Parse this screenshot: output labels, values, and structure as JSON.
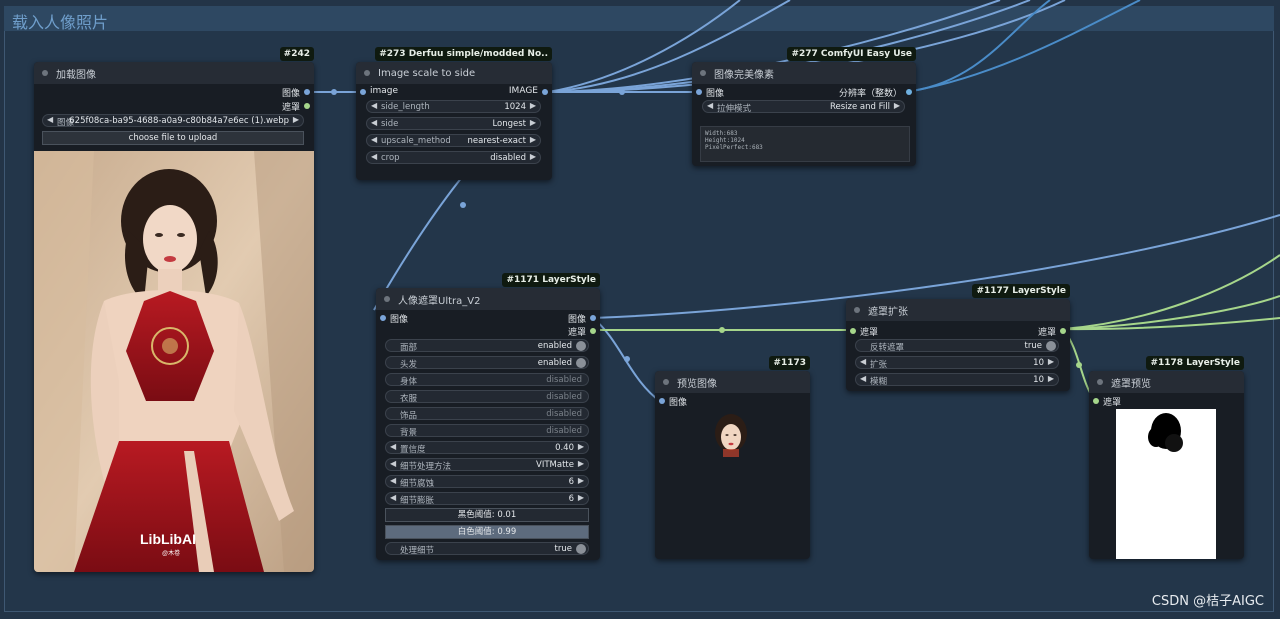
{
  "group": {
    "title": "载入人像照片"
  },
  "nodes": {
    "load_image": {
      "badge": "#242",
      "title": "加载图像",
      "outputs": [
        "图像",
        "遮罩"
      ],
      "image_label": "图像",
      "image_value": "625f08ca-ba95-4688-a0a9-c80b84a7e6ec (1).webp",
      "upload_label": "choose file to upload",
      "preview_brand": "LibLibAI",
      "preview_sub": "@木卷"
    },
    "scale": {
      "badge": "#273 Derfuu simple/modded No..",
      "title": "Image scale to side",
      "input": "image",
      "output": "IMAGE",
      "widgets": [
        {
          "label": "side_length",
          "value": "1024"
        },
        {
          "label": "side",
          "value": "Longest"
        },
        {
          "label": "upscale_method",
          "value": "nearest-exact"
        },
        {
          "label": "crop",
          "value": "disabled"
        }
      ]
    },
    "pixel": {
      "badge": "#277 ComfyUI Easy Use",
      "title": "图像完美像素",
      "input": "图像",
      "output": "分辨率（整数）",
      "widget": {
        "label": "拉伸模式",
        "value": "Resize and Fill"
      },
      "info": [
        "Width:683",
        "Height:1024",
        "PixelPerfect:683"
      ]
    },
    "mask_ultra": {
      "badge": "#1171 LayerStyle",
      "title": "人像遮罩Ultra_V2",
      "input": "图像",
      "outputs": [
        "图像",
        "遮罩"
      ],
      "toggles": [
        {
          "label": "面部",
          "value": "enabled"
        },
        {
          "label": "头发",
          "value": "enabled"
        },
        {
          "label": "身体",
          "value": "disabled"
        },
        {
          "label": "衣服",
          "value": "disabled"
        },
        {
          "label": "饰品",
          "value": "disabled"
        },
        {
          "label": "背景",
          "value": "disabled"
        }
      ],
      "numbers": [
        {
          "label": "置信度",
          "value": "0.40"
        },
        {
          "label": "细节处理方法",
          "value": "VITMatte"
        },
        {
          "label": "细节腐蚀",
          "value": "6"
        },
        {
          "label": "细节膨胀",
          "value": "6"
        }
      ],
      "black_point": "黑色阈值: 0.01",
      "white_point": "白色阈值: 0.99",
      "process_detail": {
        "label": "处理细节",
        "value": "true"
      }
    },
    "preview": {
      "badge": "#1173",
      "title": "预览图像",
      "input": "图像"
    },
    "mask_grow": {
      "badge": "#1177 LayerStyle",
      "title": "遮罩扩张",
      "input": "遮罩",
      "output": "遮罩",
      "invert": {
        "label": "反转遮罩",
        "value": "true"
      },
      "widgets": [
        {
          "label": "扩张",
          "value": "10"
        },
        {
          "label": "模糊",
          "value": "10"
        }
      ]
    },
    "mask_preview": {
      "badge": "#1178 LayerStyle",
      "title": "遮罩预览",
      "input": "遮罩"
    }
  },
  "colors": {
    "image_link": "#7aa4d8",
    "mask_link": "#a6d68b",
    "int_link": "#4a8cc8",
    "background": "#23364a"
  },
  "watermark": "CSDN @桔子AIGC"
}
